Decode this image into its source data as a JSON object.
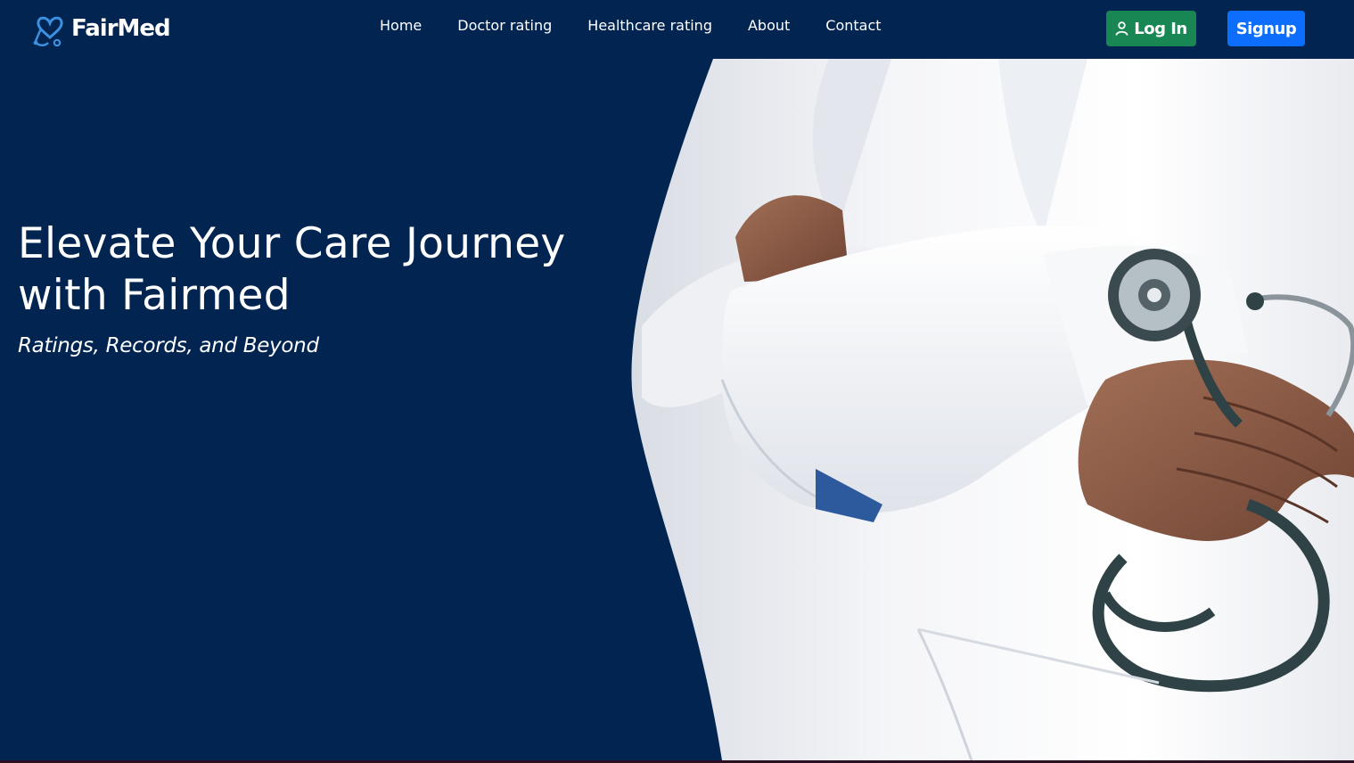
{
  "brand": {
    "name": "FairMed",
    "logo_icon": "heart-stethoscope-icon",
    "accent_color": "#3d8fe0"
  },
  "nav": {
    "links": [
      {
        "label": "Home"
      },
      {
        "label": "Doctor rating"
      },
      {
        "label": "Healthcare rating"
      },
      {
        "label": "About"
      },
      {
        "label": "Contact"
      }
    ]
  },
  "auth": {
    "login_label": "Log In",
    "login_icon": "user-icon",
    "login_color": "#198754",
    "signup_label": "Signup",
    "signup_color": "#0d6efd"
  },
  "hero": {
    "title": "Elevate Your Care Journey with Fairmed",
    "subtitle": "Ratings, Records, and Beyond",
    "image": "doctor-with-stethoscope-photo",
    "background_color": "#012450"
  }
}
